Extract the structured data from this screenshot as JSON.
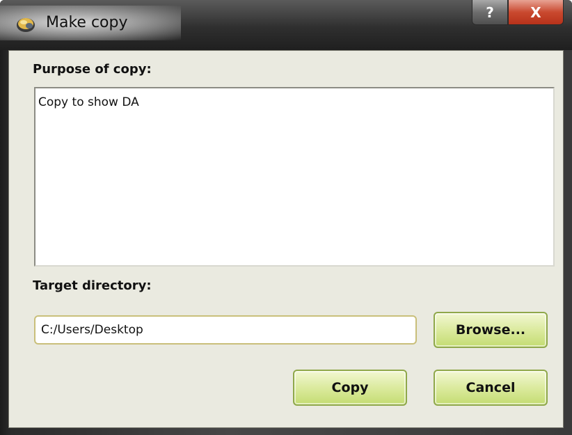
{
  "window": {
    "title": "Make copy",
    "help_glyph": "?",
    "close_glyph": "X"
  },
  "icons": {
    "app": "app-gear-icon",
    "help": "question-mark-icon",
    "close": "close-x-icon"
  },
  "colors": {
    "client_bg": "#eaeae0",
    "button_green": "#d9e99a",
    "close_red": "#c9492f"
  },
  "form": {
    "purpose_label": "Purpose of copy:",
    "purpose_value": "Copy to show DA",
    "target_label": "Target directory:",
    "target_value": "C:/Users/Desktop"
  },
  "buttons": {
    "browse": "Browse...",
    "copy": "Copy",
    "cancel": "Cancel"
  }
}
